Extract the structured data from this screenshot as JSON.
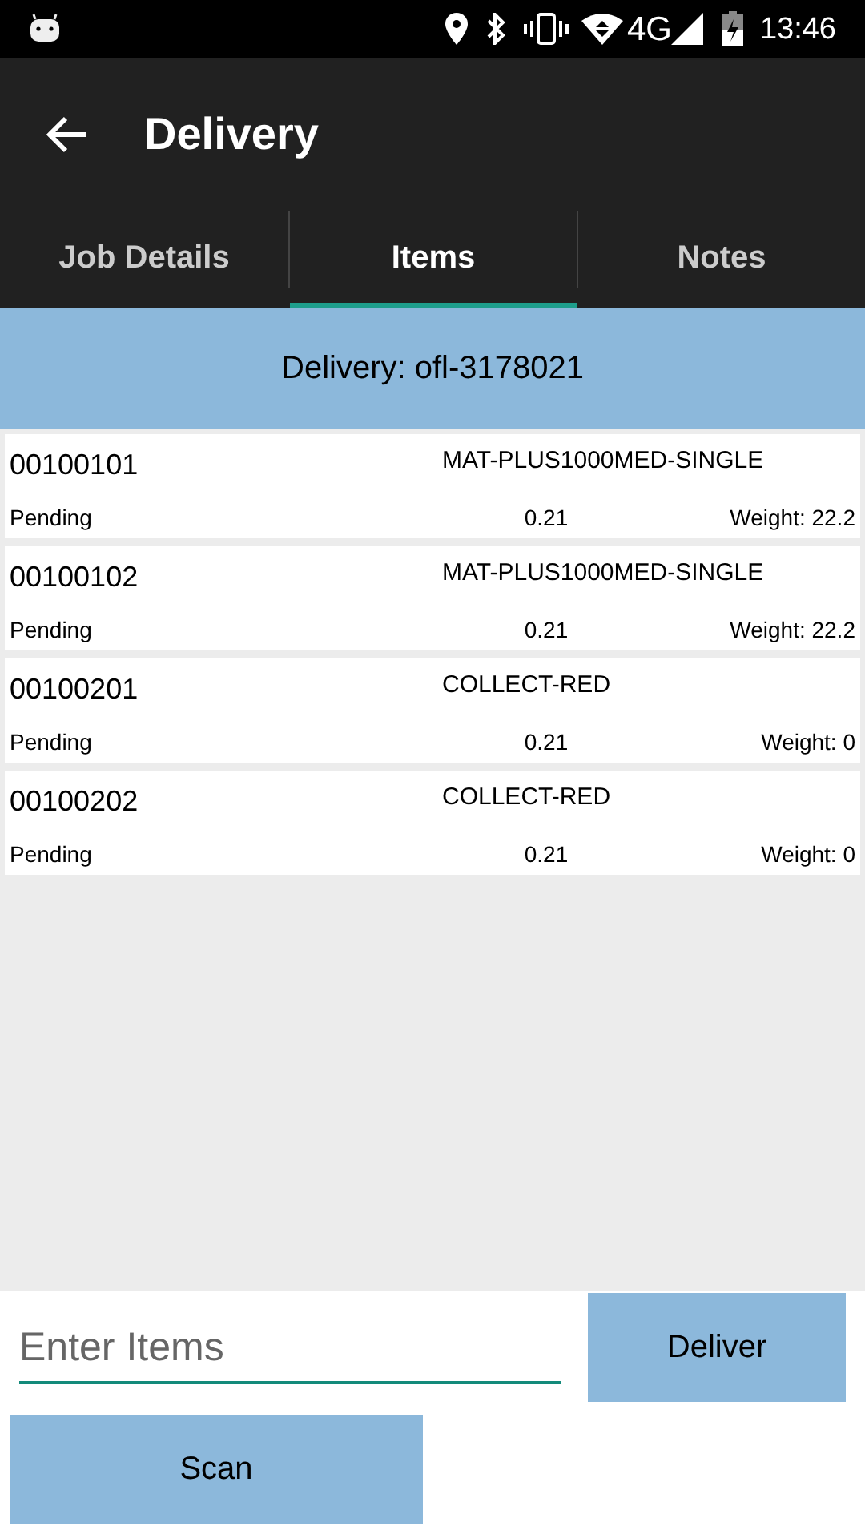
{
  "status_bar": {
    "network": "4G",
    "time": "13:46"
  },
  "app_bar": {
    "title": "Delivery"
  },
  "tabs": [
    {
      "label": "Job Details",
      "selected": false
    },
    {
      "label": "Items",
      "selected": true
    },
    {
      "label": "Notes",
      "selected": false
    }
  ],
  "header": "Delivery: ofl-3178021",
  "items": [
    {
      "code": "00100101",
      "product": "MAT-PLUS1000MED-SINGLE",
      "status": "Pending",
      "value": "0.21",
      "weight": "Weight: 22.2"
    },
    {
      "code": "00100102",
      "product": "MAT-PLUS1000MED-SINGLE",
      "status": "Pending",
      "value": "0.21",
      "weight": "Weight: 22.2"
    },
    {
      "code": "00100201",
      "product": "COLLECT-RED",
      "status": "Pending",
      "value": "0.21",
      "weight": "Weight: 0"
    },
    {
      "code": "00100202",
      "product": "COLLECT-RED",
      "status": "Pending",
      "value": "0.21",
      "weight": "Weight: 0"
    }
  ],
  "entry": {
    "placeholder": "Enter Items"
  },
  "buttons": {
    "deliver": "Deliver",
    "scan": "Scan"
  }
}
